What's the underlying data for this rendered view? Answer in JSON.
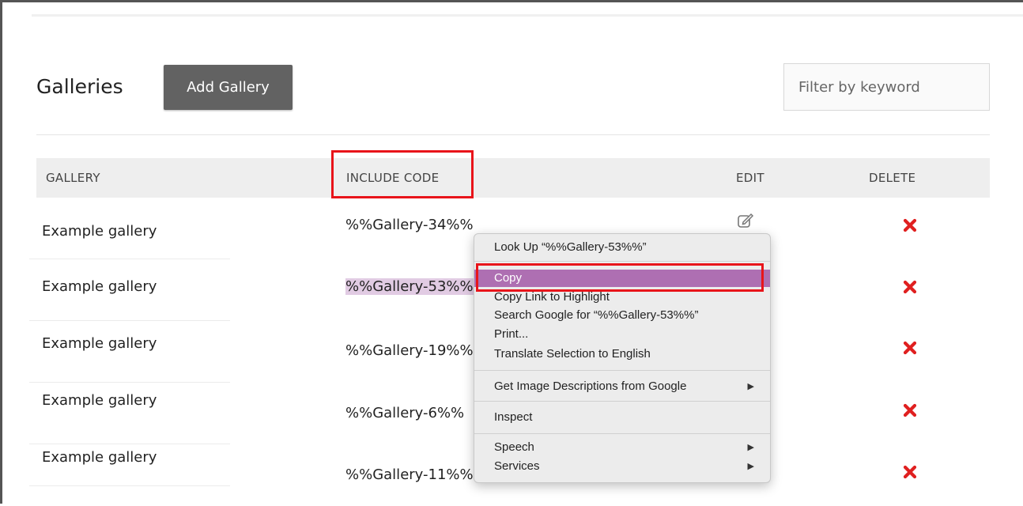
{
  "header": {
    "title": "Galleries",
    "add_button_label": "Add Gallery",
    "filter_placeholder": "Filter by keyword"
  },
  "table": {
    "columns": [
      "GALLERY",
      "INCLUDE CODE",
      "EDIT",
      "DELETE"
    ],
    "rows": [
      {
        "gallery": "Example gallery",
        "code": "%%Gallery-34%%"
      },
      {
        "gallery": "Example gallery",
        "code": "%%Gallery-53%%"
      },
      {
        "gallery": "Example gallery",
        "code": "%%Gallery-19%%"
      },
      {
        "gallery": "Example gallery",
        "code": "%%Gallery-6%%"
      },
      {
        "gallery": "Example gallery",
        "code": "%%Gallery-11%%"
      }
    ],
    "selected_row": 1,
    "edit_icon": "edit-pencil-icon",
    "delete_icon": "red-x-icon"
  },
  "context_menu": {
    "items": [
      {
        "label": "Look Up “%%Gallery-53%%”"
      },
      {
        "label": "Copy",
        "active": true
      },
      {
        "label": "Copy Link to Highlight"
      },
      {
        "label": "Search Google for “%%Gallery-53%%”"
      },
      {
        "label": "Print..."
      },
      {
        "label": "Translate Selection to English"
      },
      {
        "label": "Get Image Descriptions from Google",
        "submenu": true
      },
      {
        "label": "Inspect"
      },
      {
        "label": "Speech",
        "submenu": true
      },
      {
        "label": "Services",
        "submenu": true
      }
    ],
    "submenu_arrow": "▶"
  },
  "colors": {
    "highlight_box": "#e8141a",
    "menu_active": "#ae6fb2",
    "selection": "#e1cbe3",
    "delete_red": "#e02020",
    "add_button_bg": "#626262"
  }
}
